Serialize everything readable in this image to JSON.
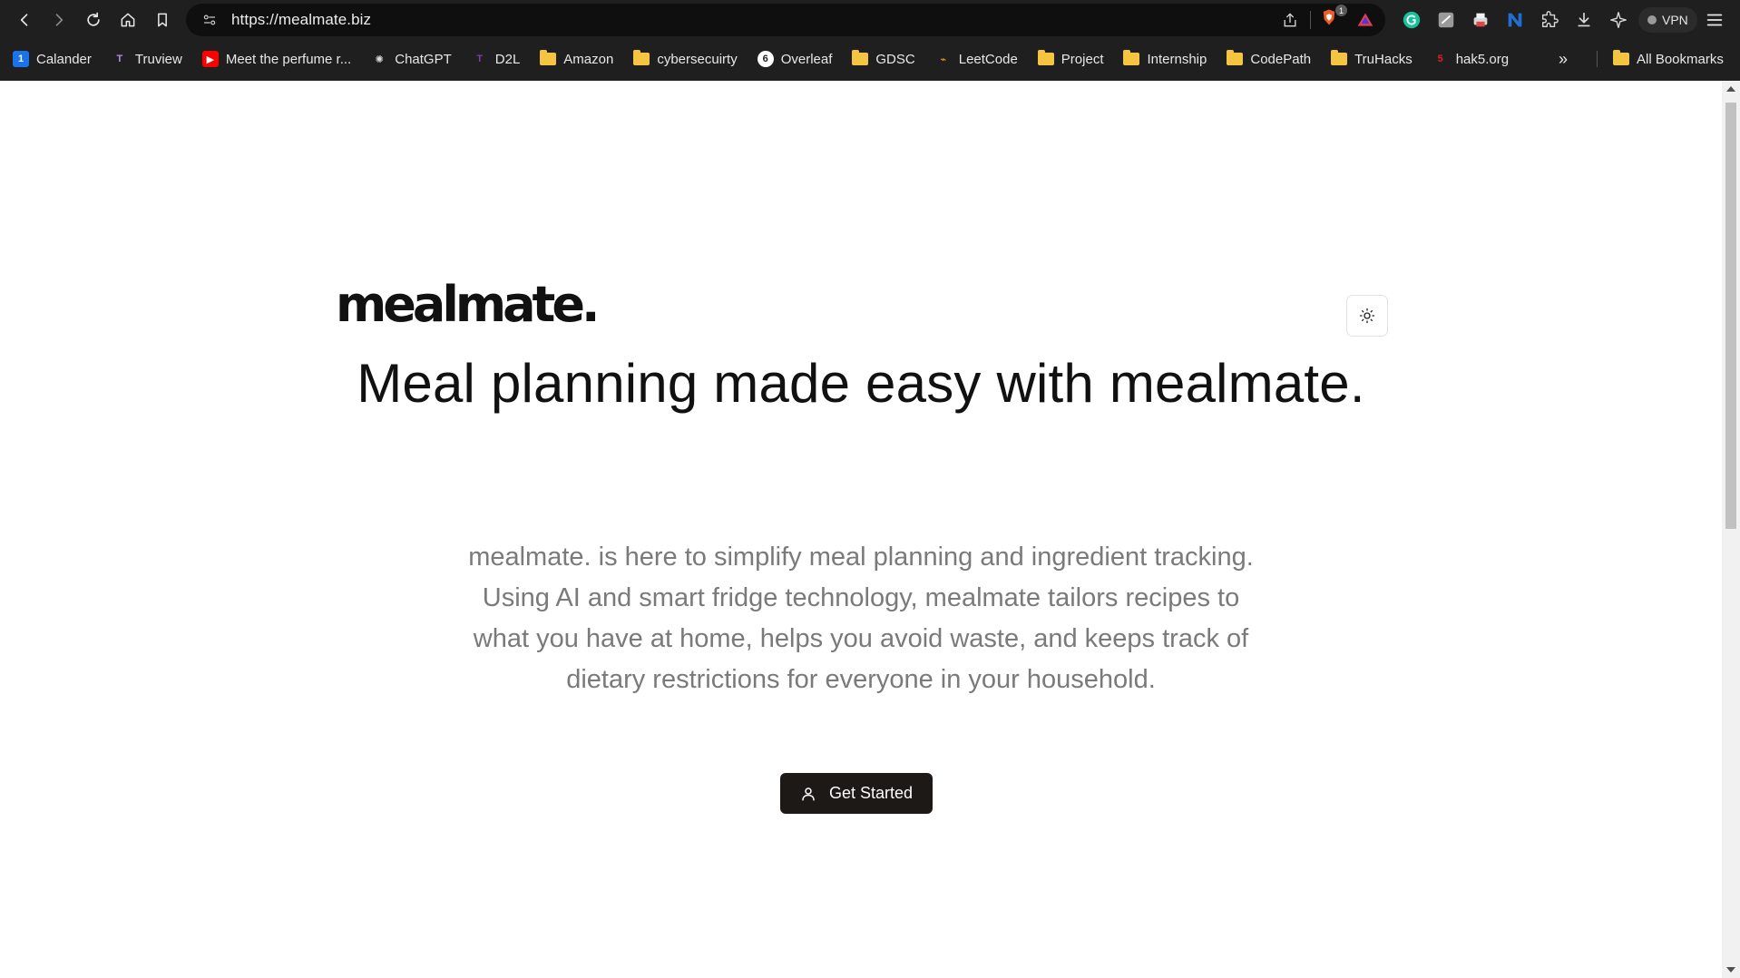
{
  "browser": {
    "url": "https://mealmate.biz",
    "shield_badge": "1",
    "vpn_label": "VPN"
  },
  "bookmarks": [
    {
      "label": "Calander",
      "icon": "calendar-icon"
    },
    {
      "label": "Truview",
      "icon": "truview-icon"
    },
    {
      "label": "Meet the perfume r...",
      "icon": "youtube-icon"
    },
    {
      "label": "ChatGPT",
      "icon": "chatgpt-icon"
    },
    {
      "label": "D2L",
      "icon": "d2l-icon"
    },
    {
      "label": "Amazon",
      "icon": "folder-icon"
    },
    {
      "label": "cybersecuirty",
      "icon": "folder-icon"
    },
    {
      "label": "Overleaf",
      "icon": "overleaf-icon"
    },
    {
      "label": "GDSC",
      "icon": "folder-icon"
    },
    {
      "label": "LeetCode",
      "icon": "leetcode-icon"
    },
    {
      "label": "Project",
      "icon": "folder-icon"
    },
    {
      "label": "Internship",
      "icon": "folder-icon"
    },
    {
      "label": "CodePath",
      "icon": "folder-icon"
    },
    {
      "label": "TruHacks",
      "icon": "folder-icon"
    },
    {
      "label": "hak5.org",
      "icon": "hak5-icon"
    }
  ],
  "bookmarks_overflow": "»",
  "all_bookmarks": "All Bookmarks",
  "page": {
    "logo": "mealmate.",
    "headline": "Meal planning made easy with mealmate.",
    "description": "mealmate. is here to simplify meal planning and ingredient tracking. Using AI and smart fridge technology, mealmate tailors recipes to what you have at home, helps you avoid waste, and keeps track of dietary restrictions for everyone in your household.",
    "cta_label": "Get Started"
  },
  "colors": {
    "chrome_bg": "#1f1f1f",
    "cta_bg": "#1c1917",
    "subtext": "#7a7a7a"
  }
}
